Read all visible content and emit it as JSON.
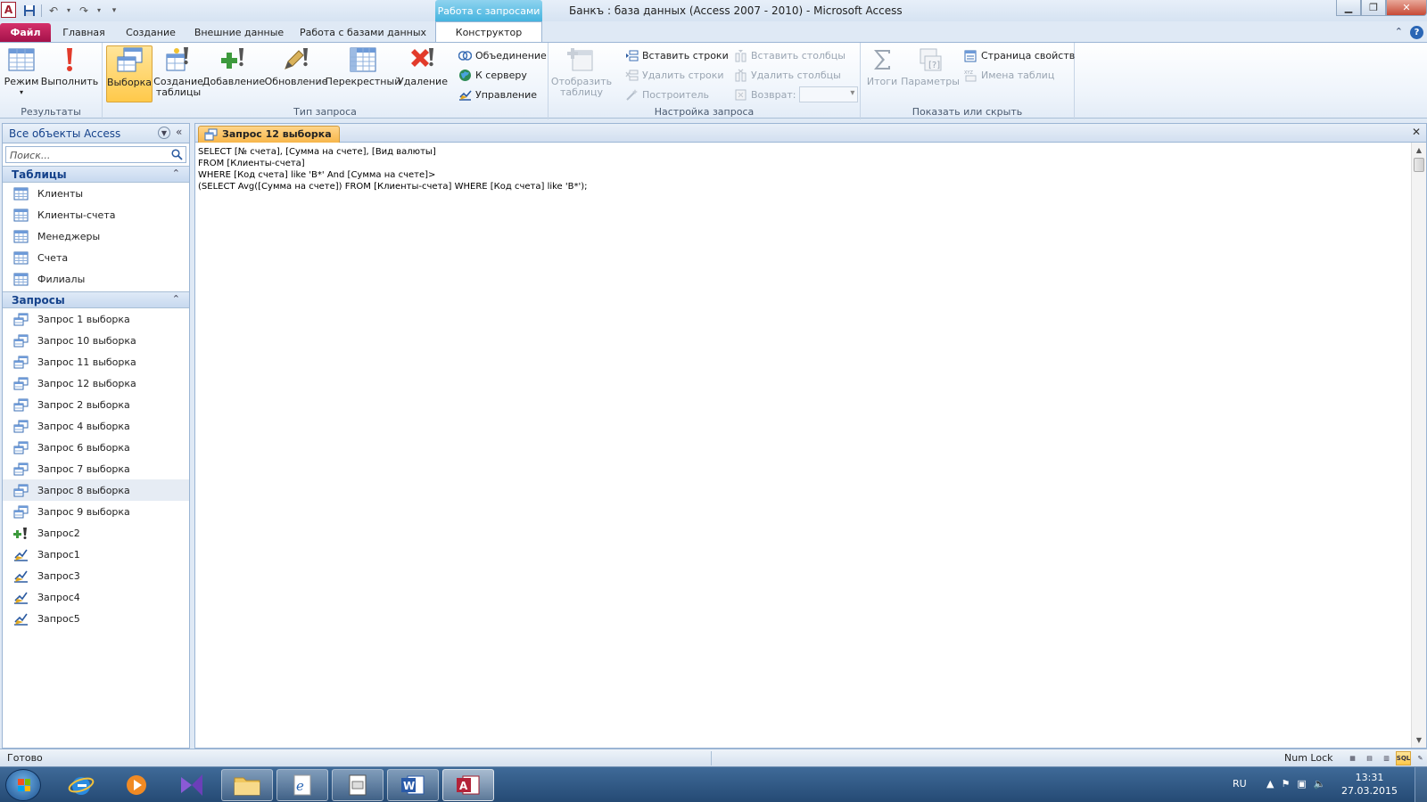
{
  "window": {
    "title": "Банкъ : база данных (Access 2007 - 2010)  -  Microsoft Access",
    "context_tab_header": "Работа с запросами",
    "app_icon_letter": "A"
  },
  "ribbon_tabs": [
    {
      "label": "Файл"
    },
    {
      "label": "Главная"
    },
    {
      "label": "Создание"
    },
    {
      "label": "Внешние данные"
    },
    {
      "label": "Работа с базами данных"
    },
    {
      "label": "Конструктор"
    }
  ],
  "ribbon": {
    "results": {
      "label": "Результаты",
      "mode": "Режим",
      "run": "Выполнить"
    },
    "query_type": {
      "label": "Тип запроса",
      "select": "Выборка",
      "make_table_1": "Создание",
      "make_table_2": "таблицы",
      "append": "Добавление",
      "update": "Обновление",
      "crosstab": "Перекрестный",
      "delete": "Удаление",
      "union": "Объединение",
      "pass_through": "К серверу",
      "data_definition": "Управление"
    },
    "query_setup": {
      "label": "Настройка запроса",
      "show_table_1": "Отобразить",
      "show_table_2": "таблицу",
      "insert_rows": "Вставить строки",
      "delete_rows": "Удалить строки",
      "builder": "Построитель",
      "insert_columns": "Вставить столбцы",
      "delete_columns": "Удалить столбцы",
      "return": "Возврат:"
    },
    "show_hide": {
      "label": "Показать или скрыть",
      "totals": "Итоги",
      "parameters": "Параметры",
      "property_sheet": "Страница свойств",
      "table_names": "Имена таблиц"
    }
  },
  "nav": {
    "title": "Все объекты Access",
    "search_placeholder": "Поиск...",
    "tables_label": "Таблицы",
    "tables": [
      {
        "label": "Клиенты"
      },
      {
        "label": "Клиенты-счета"
      },
      {
        "label": "Менеджеры"
      },
      {
        "label": "Счета"
      },
      {
        "label": "Филиалы"
      }
    ],
    "queries_label": "Запросы",
    "queries": [
      {
        "label": "Запрос 1 выборка",
        "kind": "select"
      },
      {
        "label": "Запрос 10 выборка",
        "kind": "select"
      },
      {
        "label": "Запрос 11 выборка",
        "kind": "select"
      },
      {
        "label": "Запрос 12 выборка",
        "kind": "select"
      },
      {
        "label": "Запрос 2 выборка",
        "kind": "select"
      },
      {
        "label": "Запрос 4 выборка",
        "kind": "select"
      },
      {
        "label": "Запрос 6 выборка",
        "kind": "select"
      },
      {
        "label": "Запрос 7 выборка",
        "kind": "select"
      },
      {
        "label": "Запрос 8 выборка",
        "kind": "select"
      },
      {
        "label": "Запрос 9 выборка",
        "kind": "select"
      },
      {
        "label": "Запрос2",
        "kind": "append"
      },
      {
        "label": "Запрос1",
        "kind": "ddl"
      },
      {
        "label": "Запрос3",
        "kind": "ddl"
      },
      {
        "label": "Запрос4",
        "kind": "ddl"
      },
      {
        "label": "Запрос5",
        "kind": "ddl"
      }
    ],
    "hovered_query": "Запрос 8 выборка"
  },
  "document": {
    "tab_label": "Запрос 12 выборка",
    "sql_lines": [
      "SELECT [№ счета], [Сумма на счете], [Вид валюты]",
      "FROM [Клиенты-счета]",
      "WHERE [Код счета] like 'B*' And [Сумма на счете]>",
      "(SELECT Avg([Сумма на счете]) FROM [Клиенты-счета] WHERE [Код счета] like 'B*');"
    ]
  },
  "status": {
    "text": "Готово",
    "num_lock": "Num Lock",
    "sql_view": "SQL"
  },
  "taskbar": {
    "language": "RU",
    "time": "13:31",
    "date": "27.03.2015"
  },
  "colors": {
    "file_tab": "#c41e5a",
    "context_tab": "#45b4df",
    "selected_button": "#ffc94a",
    "nav_title": "#15428b"
  }
}
